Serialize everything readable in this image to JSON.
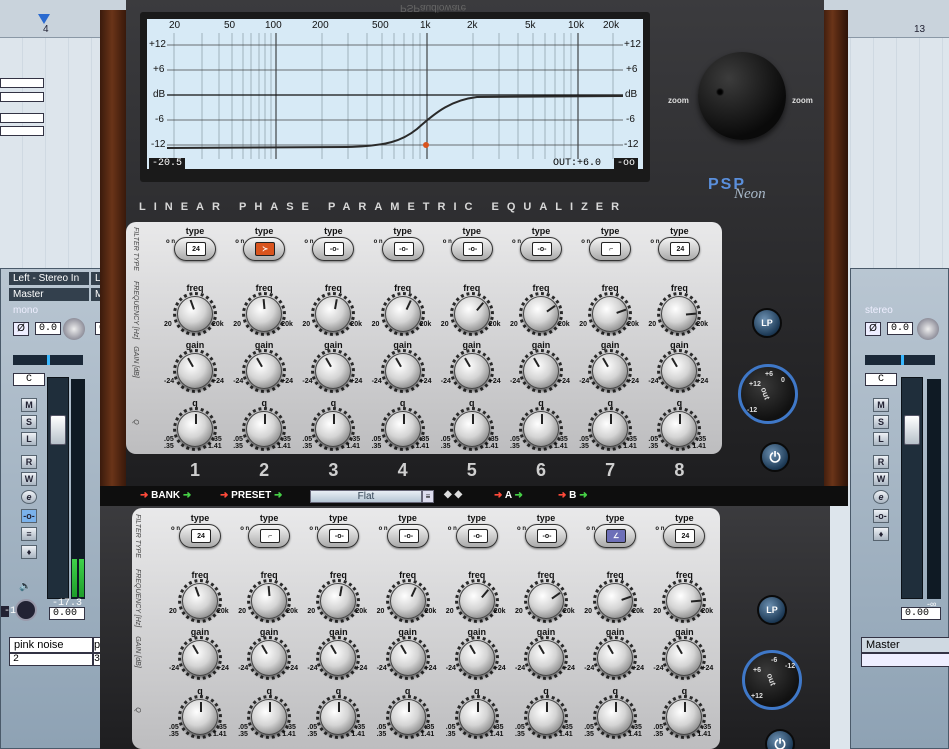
{
  "daw": {
    "ruler": {
      "left_marker": "4",
      "right_marker": "13"
    },
    "left_mixer": {
      "input_label": "Left - Stereo In",
      "input_label_2": "L",
      "output_label": "Master",
      "output_label_2": "M",
      "mode": "mono",
      "pan_value": "0.0",
      "pan_value_2": "0.",
      "pan_readout": "C",
      "buttons": [
        "M",
        "S",
        "L",
        "R",
        "W"
      ],
      "fader_readout": "0.00",
      "meter_readout": "-17.3",
      "meter_readout_2": "-1",
      "channel_name": "pink noise",
      "channel_name_2": "pi",
      "channel_index": "2",
      "channel_index_2": "3"
    },
    "right_mixer": {
      "mode": "stereo",
      "pan_value": "0.0",
      "pan_readout": "C",
      "buttons": [
        "M",
        "S",
        "L",
        "R",
        "W"
      ],
      "fader_readout": "0.00",
      "meter_readout": "-∞",
      "channel_name": "Master"
    }
  },
  "plugin": {
    "brand": "PSP",
    "product": "Neon",
    "mirrored_logo": "PSPaudioware",
    "title": "LINEAR PHASE PARAMETRIC EQUALIZER",
    "screen": {
      "freq_labels": [
        "20",
        "50",
        "100",
        "200",
        "500",
        "1k",
        "2k",
        "5k",
        "10k",
        "20k"
      ],
      "db_labels_left": [
        "+12",
        "+6",
        "dB",
        "-6",
        "-12"
      ],
      "db_labels_right": [
        "+12",
        "+6",
        "dB",
        "-6",
        "-12"
      ],
      "in_readout": "-20.5",
      "out_readout": "OUT:+6.0",
      "peak_readout": "-oo"
    },
    "zoom_label": "zoom",
    "row_labels": {
      "type": "FILTER TYPE",
      "freq": "FREQUENCY [Hz]",
      "gain": "GAIN [dB]",
      "q": "Q"
    },
    "labels": {
      "type": "type",
      "freq": "freq",
      "gain": "gain",
      "q": "q",
      "on": "o n"
    },
    "ranges": {
      "freq_min": "20",
      "freq_max": "20k",
      "gain_min": "-24",
      "gain_max": "+24",
      "q_min": ".05",
      "q_min_2": ".35",
      "q_max": ".35",
      "q_max_2": "1.41"
    },
    "upper_bands": [
      {
        "num": "1",
        "type": "24",
        "type_active": false
      },
      {
        "num": "2",
        "type": "lp",
        "type_active": true
      },
      {
        "num": "3",
        "type": "bell",
        "type_active": false
      },
      {
        "num": "4",
        "type": "bell",
        "type_active": false
      },
      {
        "num": "5",
        "type": "bell",
        "type_active": false
      },
      {
        "num": "6",
        "type": "bell",
        "type_active": false
      },
      {
        "num": "7",
        "type": "shelf",
        "type_active": false
      },
      {
        "num": "8",
        "type": "24",
        "type_active": false
      }
    ],
    "lower_bands": [
      {
        "type": "24",
        "type_active": false
      },
      {
        "type": "shelf",
        "type_active": false
      },
      {
        "type": "bell",
        "type_active": false
      },
      {
        "type": "bell",
        "type_active": false
      },
      {
        "type": "bell",
        "type_active": false
      },
      {
        "type": "bell",
        "type_active": false
      },
      {
        "type": "hs",
        "type_active": true
      },
      {
        "type": "24",
        "type_active": false
      }
    ],
    "lp_label": "LP",
    "out_label": "out",
    "out_scale": [
      "+6",
      "+12",
      "-12",
      "-6",
      "0"
    ],
    "lower_out_scale": [
      "-6",
      "-12",
      "+12",
      "+6"
    ],
    "bar": {
      "bank": "BANK",
      "preset": "PRESET",
      "preset_value": "Flat",
      "a": "A",
      "b": "B"
    }
  },
  "colors": {
    "accent_orange": "#d9541e",
    "accent_blue": "#3f78c8",
    "curve": "#2a2a2a"
  }
}
